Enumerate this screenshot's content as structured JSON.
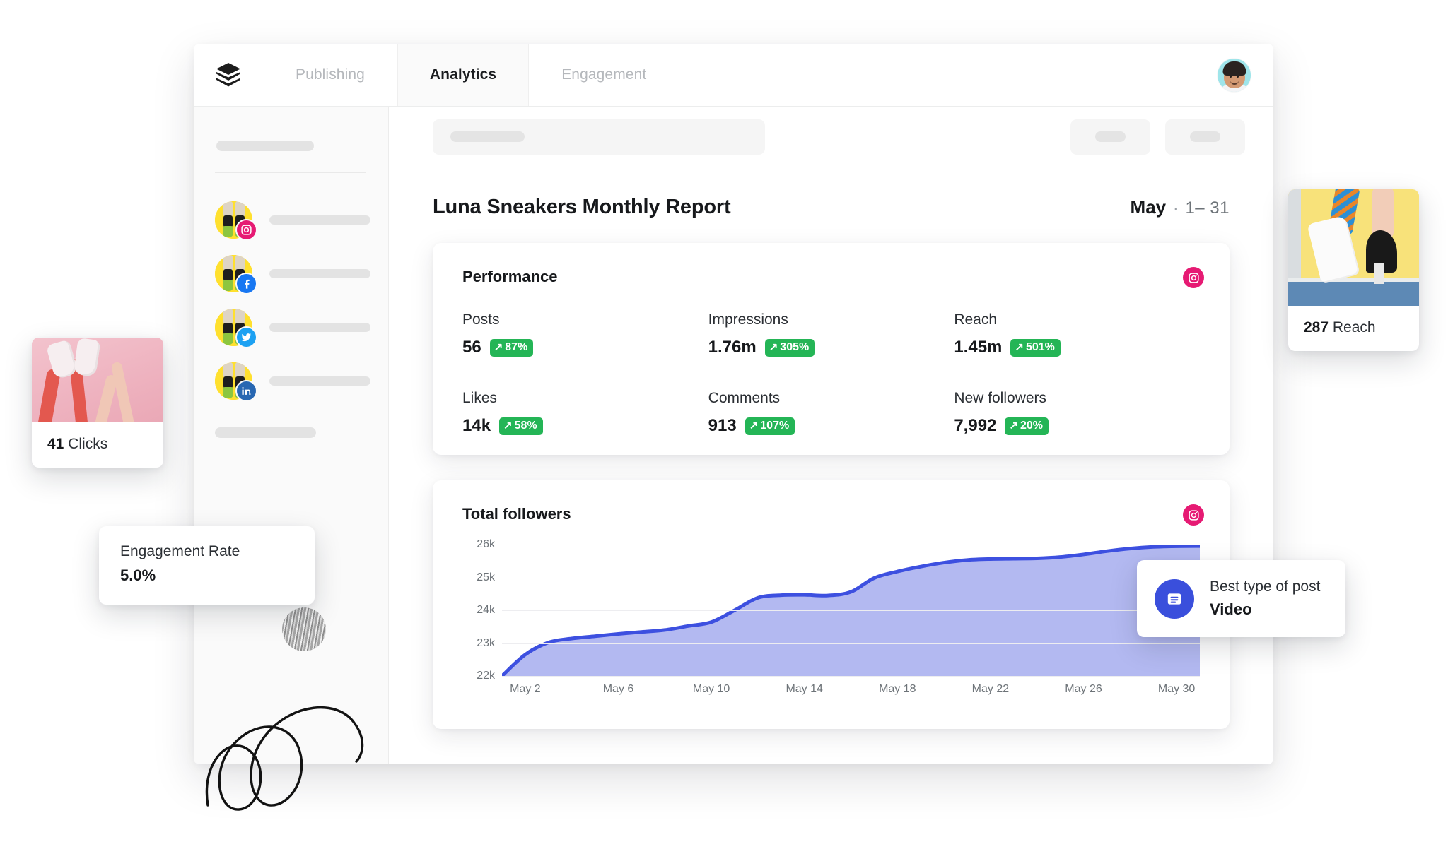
{
  "app": {
    "logo_name": "buffer-layers-logo",
    "tabs": [
      {
        "label": "Publishing",
        "active": false
      },
      {
        "label": "Analytics",
        "active": true
      },
      {
        "label": "Engagement",
        "active": false
      }
    ],
    "avatar_name": "user-avatar"
  },
  "sidebar": {
    "accounts": [
      {
        "network": "instagram"
      },
      {
        "network": "facebook"
      },
      {
        "network": "twitter"
      },
      {
        "network": "linkedin"
      }
    ]
  },
  "report": {
    "title": "Luna Sneakers Monthly Report",
    "month": "May",
    "separator": "·",
    "range": "1– 31"
  },
  "performance": {
    "title": "Performance",
    "network": "instagram",
    "metrics": [
      {
        "label": "Posts",
        "value": "56",
        "delta": "87%",
        "arrow": "↗",
        "trend": "up"
      },
      {
        "label": "Impressions",
        "value": "1.76m",
        "delta": "305%",
        "arrow": "↗",
        "trend": "up"
      },
      {
        "label": "Reach",
        "value": "1.45m",
        "delta": "501%",
        "arrow": "↗",
        "trend": "up"
      },
      {
        "label": "Likes",
        "value": "14k",
        "delta": "58%",
        "arrow": "↗",
        "trend": "up"
      },
      {
        "label": "Comments",
        "value": "913",
        "delta": "107%",
        "arrow": "↗",
        "trend": "up"
      },
      {
        "label": "New followers",
        "value": "7,992",
        "delta": "20%",
        "arrow": "↗",
        "trend": "up"
      }
    ]
  },
  "followers_card": {
    "title": "Total followers",
    "network": "instagram"
  },
  "chart_data": {
    "type": "area",
    "title": "Total followers",
    "xlabel": "",
    "ylabel": "",
    "grid": true,
    "legend": false,
    "line_color": "#3d50e0",
    "fill_color": "#a8afef",
    "ylim": [
      22000,
      26000
    ],
    "yticks": [
      22000,
      23000,
      24000,
      25000,
      26000
    ],
    "ytick_labels": [
      "22k",
      "23k",
      "24k",
      "25k",
      "26k"
    ],
    "xticks": [
      "May 2",
      "May 6",
      "May 10",
      "May 14",
      "May 18",
      "May 22",
      "May 26",
      "May 30"
    ],
    "x": [
      1,
      2,
      3,
      4,
      5,
      6,
      7,
      8,
      9,
      10,
      11,
      12,
      13,
      14,
      15,
      16,
      17,
      18,
      19,
      20,
      21,
      22,
      23,
      24,
      25,
      26,
      27,
      28,
      29,
      30,
      31
    ],
    "values": [
      22000,
      22650,
      23020,
      23140,
      23210,
      23280,
      23340,
      23400,
      23520,
      23640,
      24000,
      24380,
      24460,
      24470,
      24450,
      24560,
      24980,
      25180,
      25330,
      25450,
      25530,
      25560,
      25570,
      25580,
      25620,
      25700,
      25800,
      25880,
      25930,
      25950,
      25955
    ],
    "series": [
      {
        "name": "Total followers",
        "values": [
          22000,
          22650,
          23020,
          23140,
          23210,
          23280,
          23340,
          23400,
          23520,
          23640,
          24000,
          24380,
          24460,
          24470,
          24450,
          24560,
          24980,
          25180,
          25330,
          25450,
          25530,
          25560,
          25570,
          25580,
          25620,
          25700,
          25800,
          25880,
          25930,
          25950,
          25955
        ]
      }
    ]
  },
  "floating": {
    "clicks": {
      "value": "41",
      "label": "Clicks",
      "photo_name": "sneakers-pink-photo"
    },
    "engagement": {
      "label": "Engagement Rate",
      "value": "5.0%"
    },
    "reach": {
      "value": "287",
      "label": "Reach",
      "photo_name": "sneaker-yellow-photo"
    },
    "best_post": {
      "label": "Best type of post",
      "value": "Video",
      "icon": "article-icon"
    }
  },
  "colors": {
    "accent_blue": "#3d50e0",
    "chart_fill": "#a8afef",
    "positive_green": "#24b556",
    "instagram": "#e61a73",
    "facebook": "#1877f2",
    "twitter": "#1da1f2",
    "linkedin": "#2867b2",
    "avatar_yellow": "#ffe02e"
  }
}
